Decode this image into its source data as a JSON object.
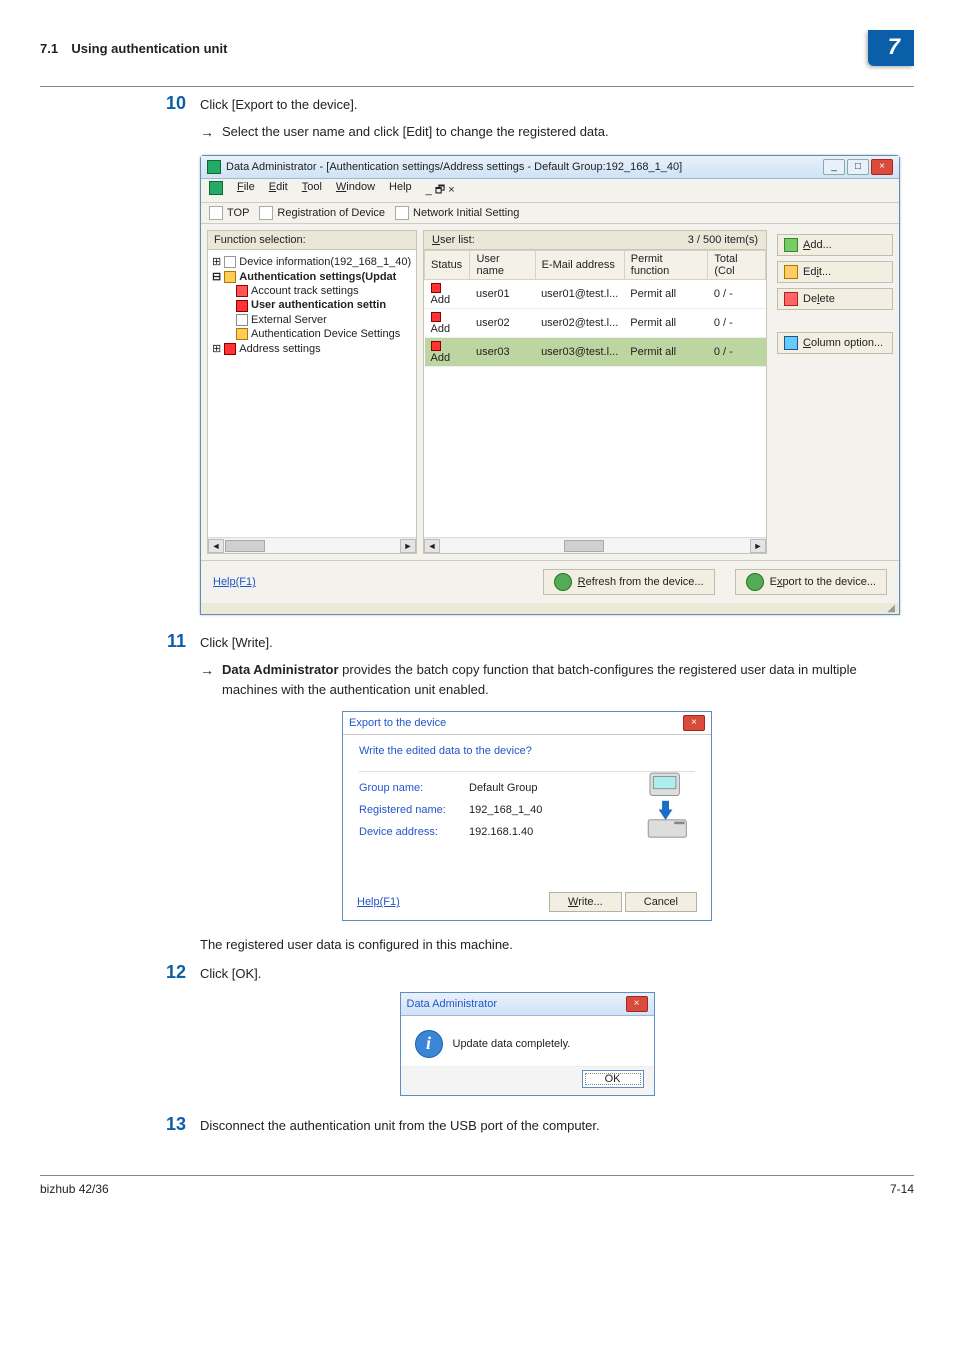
{
  "header": {
    "section": "7.1",
    "title": "Using authentication unit",
    "chapter": "7"
  },
  "step10": {
    "num": "10",
    "text_a": "Click [Export to the device].",
    "arrow": "→",
    "sub": "Select the user name and click [Edit] to change the registered data."
  },
  "win1": {
    "title": "Data Administrator - [Authentication settings/Address settings - Default Group:192_168_1_40]",
    "wb_min": "_",
    "wb_max": "□",
    "wb_close": "×",
    "mdi": "_  🗗  ×",
    "menu": {
      "file": "File",
      "edit": "Edit",
      "tool": "Tool",
      "window": "Window",
      "help": "Help"
    },
    "toolbar": {
      "top": "TOP",
      "reg": "Registration of Device",
      "net": "Network Initial Setting"
    },
    "left_head": "Function selection:",
    "tree": {
      "dev": "Device information(192_168_1_40)",
      "auth": "Authentication settings(Updat",
      "acct": "Account track settings",
      "user": "User authentication settin",
      "ext": "External Server",
      "ads": "Authentication Device Settings",
      "addr": "Address settings"
    },
    "ulist_head_left": "User list:",
    "ulist_head_right": "3 / 500 item(s)",
    "cols": {
      "status": "Status",
      "uname": "User name",
      "email": "E-Mail address",
      "perm": "Permit function",
      "total": "Total (Col"
    },
    "rows": [
      {
        "status": "Add",
        "uname": "user01",
        "email": "user01@test.l...",
        "perm": "Permit all",
        "total": "0 / -"
      },
      {
        "status": "Add",
        "uname": "user02",
        "email": "user02@test.l...",
        "perm": "Permit all",
        "total": "0 / -"
      },
      {
        "status": "Add",
        "uname": "user03",
        "email": "user03@test.l...",
        "perm": "Permit all",
        "total": "0 / -"
      }
    ],
    "rbtn": {
      "add": "Add...",
      "edit": "Edit...",
      "delete": "Delete",
      "column": "Column option..."
    },
    "help": "Help(F1)",
    "refresh": "Refresh from the device...",
    "export": "Export to the device..."
  },
  "step11": {
    "num": "11",
    "text": "Click [Write].",
    "arrow": "→",
    "sub_a": "Data Administrator",
    "sub_b": " provides the batch copy function that batch-configures the registered user data in multiple machines with the authentication unit enabled."
  },
  "dlg2": {
    "title": "Export to the device",
    "msg": "Write the edited data to the device?",
    "rows": [
      {
        "lab": "Group name:",
        "val": "Default Group"
      },
      {
        "lab": "Registered name:",
        "val": "192_168_1_40"
      },
      {
        "lab": "Device address:",
        "val": "192.168.1.40"
      }
    ],
    "help": "Help(F1)",
    "write": "Write...",
    "cancel": "Cancel"
  },
  "post11": "The registered user data is configured in this machine.",
  "step12": {
    "num": "12",
    "text": "Click [OK]."
  },
  "dlg3": {
    "title": "Data Administrator",
    "msg": "Update data completely.",
    "ok": "OK"
  },
  "step13": {
    "num": "13",
    "text": "Disconnect the authentication unit from the USB port of the computer."
  },
  "footer": {
    "left": "bizhub 42/36",
    "right": "7-14"
  }
}
